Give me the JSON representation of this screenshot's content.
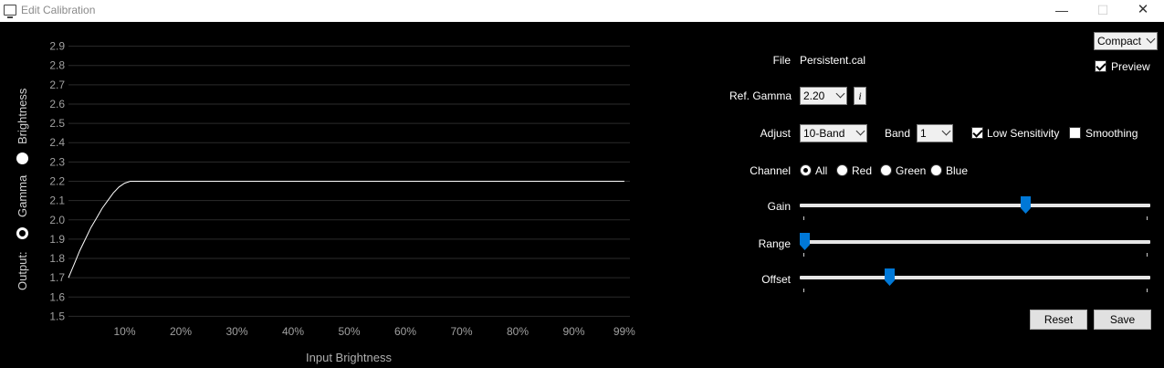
{
  "window": {
    "title": "Edit Calibration",
    "min_glyph": "—",
    "max_glyph": "☐",
    "close_glyph": "✕"
  },
  "side": {
    "output_label": "Output:",
    "gamma_label": "Gamma",
    "brightness_label": "Brightness",
    "selected": "Gamma"
  },
  "chart_data": {
    "type": "line",
    "xlabel": "Input Brightness",
    "ylabel": "",
    "x_ticks": [
      "10%",
      "20%",
      "30%",
      "40%",
      "50%",
      "60%",
      "70%",
      "80%",
      "90%",
      "99%"
    ],
    "y_ticks": [
      "1.5",
      "1.6",
      "1.7",
      "1.8",
      "1.9",
      "2.0",
      "2.1",
      "2.2",
      "2.3",
      "2.4",
      "2.5",
      "2.6",
      "2.7",
      "2.8",
      "2.9"
    ],
    "xlim": [
      0,
      100
    ],
    "ylim": [
      1.45,
      2.95
    ],
    "grid": true,
    "series": [
      {
        "x": [
          0,
          1,
          2,
          3,
          4,
          5,
          6,
          7,
          8,
          9,
          10,
          11,
          12,
          13,
          14,
          20,
          30,
          40,
          50,
          60,
          70,
          80,
          90,
          99
        ],
        "y": [
          1.7,
          1.77,
          1.84,
          1.9,
          1.96,
          2.01,
          2.06,
          2.1,
          2.14,
          2.17,
          2.19,
          2.2,
          2.2,
          2.2,
          2.2,
          2.2,
          2.2,
          2.2,
          2.2,
          2.2,
          2.2,
          2.2,
          2.2,
          2.2
        ]
      }
    ]
  },
  "panel": {
    "view_mode": "Compact",
    "preview_label": "Preview",
    "preview_checked": true,
    "file_label": "File",
    "file_value": "Persistent.cal",
    "ref_gamma_label": "Ref. Gamma",
    "ref_gamma_value": "2.20",
    "info_label": "i",
    "adjust_label": "Adjust",
    "adjust_value": "10-Band",
    "band_label": "Band",
    "band_value": "1",
    "low_sensitivity_label": "Low Sensitivity",
    "low_sensitivity_checked": true,
    "smoothing_label": "Smoothing",
    "smoothing_checked": false,
    "channel_label": "Channel",
    "channels": [
      "All",
      "Red",
      "Green",
      "Blue"
    ],
    "channel_selected": "All",
    "gain_label": "Gain",
    "gain_level": 0.65,
    "range_label": "Range",
    "range_level": 0.0,
    "offset_label": "Offset",
    "offset_level": 0.25,
    "reset_label": "Reset",
    "save_label": "Save"
  },
  "colors": {
    "accent": "#0078d7",
    "grid": "#2b2b2b",
    "axis_text": "#a0a0a0",
    "curve": "#ffffff"
  }
}
